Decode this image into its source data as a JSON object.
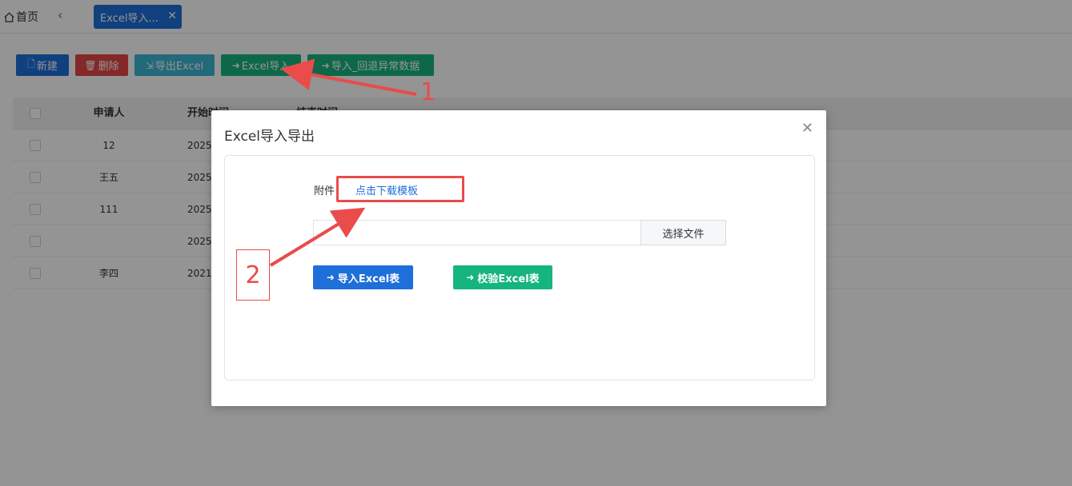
{
  "topbar": {
    "home_label": "首页",
    "back_glyph": "‹",
    "active_tab": "Excel导入...",
    "close_glyph": "✕"
  },
  "toolbar": {
    "new_label": "新建",
    "delete_label": "删除",
    "export_label": "导出Excel",
    "import_label": "Excel导入",
    "rollback_label": "导入_回退异常数据"
  },
  "table": {
    "headers": {
      "applicant": "申请人",
      "start": "开始时间",
      "end": "结束时间"
    },
    "rows": [
      {
        "applicant": "12",
        "start": "2025-"
      },
      {
        "applicant": "王五",
        "start": "2025-"
      },
      {
        "applicant": "111",
        "start": "2025-"
      },
      {
        "applicant": "",
        "start": "2025-"
      },
      {
        "applicant": "李四",
        "start": "2021-"
      }
    ]
  },
  "modal": {
    "title": "Excel导入导出",
    "close_glyph": "✕",
    "attach_label": "附件：",
    "download_link": "点击下载模板",
    "file_input_value": "",
    "choose_file": "选择文件",
    "import_button": "导入Excel表",
    "verify_button": "校验Excel表"
  },
  "annotations": {
    "step1": "1",
    "step2": "2",
    "color": "#ea4b4b"
  },
  "colors": {
    "primary": "#1e6fd9",
    "danger": "#e54545",
    "info": "#3bb5d3",
    "success": "#16b47f"
  }
}
